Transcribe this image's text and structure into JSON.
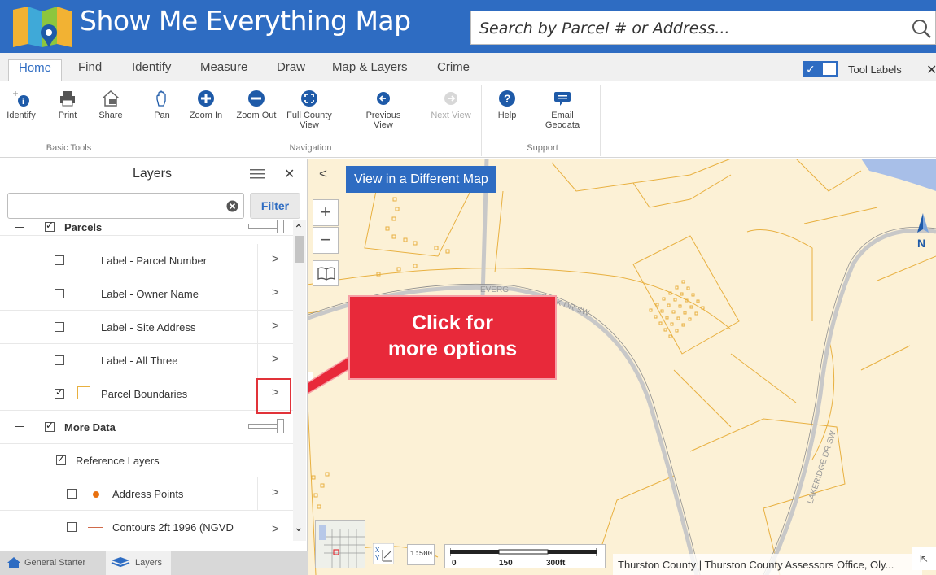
{
  "header": {
    "title": "Show Me Everything Map",
    "search_placeholder": "Search by Parcel # or Address..."
  },
  "tabs": [
    {
      "label": "Home",
      "active": true
    },
    {
      "label": "Find"
    },
    {
      "label": "Identify"
    },
    {
      "label": "Measure"
    },
    {
      "label": "Draw"
    },
    {
      "label": "Map & Layers"
    },
    {
      "label": "Crime"
    }
  ],
  "tool_labels": {
    "label": "Tool Labels",
    "enabled": true
  },
  "ribbon": {
    "basic_tools": {
      "group_label": "Basic Tools",
      "tools": [
        {
          "label": "Identify",
          "icon": "identify-icon"
        },
        {
          "label": "Print",
          "icon": "print-icon"
        },
        {
          "label": "Share",
          "icon": "share-icon"
        }
      ]
    },
    "navigation": {
      "group_label": "Navigation",
      "tools": [
        {
          "label": "Pan",
          "icon": "hand-icon"
        },
        {
          "label": "Zoom In",
          "icon": "zoom-in-icon"
        },
        {
          "label": "Zoom Out",
          "icon": "zoom-out-icon"
        },
        {
          "label_1": "Full County",
          "label_2": "View",
          "icon": "full-extent-icon"
        },
        {
          "label_1": "Previous",
          "label_2": "View",
          "icon": "previous-view-icon"
        },
        {
          "label": "Next View",
          "icon": "next-view-icon",
          "disabled": true
        }
      ]
    },
    "support": {
      "group_label": "Support",
      "tools": [
        {
          "label": "Help",
          "icon": "help-icon"
        },
        {
          "label_1": "Email",
          "label_2": "Geodata",
          "icon": "chat-icon"
        }
      ]
    }
  },
  "layers_panel": {
    "title": "Layers",
    "filter_button": "Filter",
    "items": [
      {
        "label": "Parcels",
        "checked": true,
        "level": 0,
        "group": true
      },
      {
        "label": "Label - Parcel Number",
        "checked": false,
        "level": 1
      },
      {
        "label": "Label - Owner Name",
        "checked": false,
        "level": 1
      },
      {
        "label": "Label - Site Address",
        "checked": false,
        "level": 1
      },
      {
        "label": "Label - All Three",
        "checked": false,
        "level": 1
      },
      {
        "label": "Parcel Boundaries",
        "checked": true,
        "level": 1
      },
      {
        "label": "More Data",
        "checked": true,
        "level": 0,
        "group": true
      },
      {
        "label": "Reference Layers",
        "checked": true,
        "level": 1,
        "group": true
      },
      {
        "label": "Address Points",
        "checked": false,
        "level": 2
      },
      {
        "label": "Contours 2ft 1996 (NGVD",
        "checked": false,
        "level": 2
      }
    ],
    "bottom_tabs": [
      "General Starter",
      "Layers"
    ]
  },
  "map": {
    "different_map_button": "View in a Different Map",
    "callout_line1": "Click for",
    "callout_line2": "more options",
    "street_labels": [
      "EVERG",
      "PARK DR SW",
      "LAKERIDGE DR SW"
    ],
    "north_label": "N",
    "scale_labels": [
      "0",
      "150",
      "300ft"
    ],
    "scale_icon_text": "1:500",
    "attribution": "Thurston County | Thurston County Assessors Office, Oly..."
  },
  "colors": {
    "header_blue": "#2e6cc2",
    "map_background": "#fcf1d6",
    "parcel_lines": "#e8b040",
    "callout_red": "#e8293a",
    "water": "#a8bfe8"
  }
}
